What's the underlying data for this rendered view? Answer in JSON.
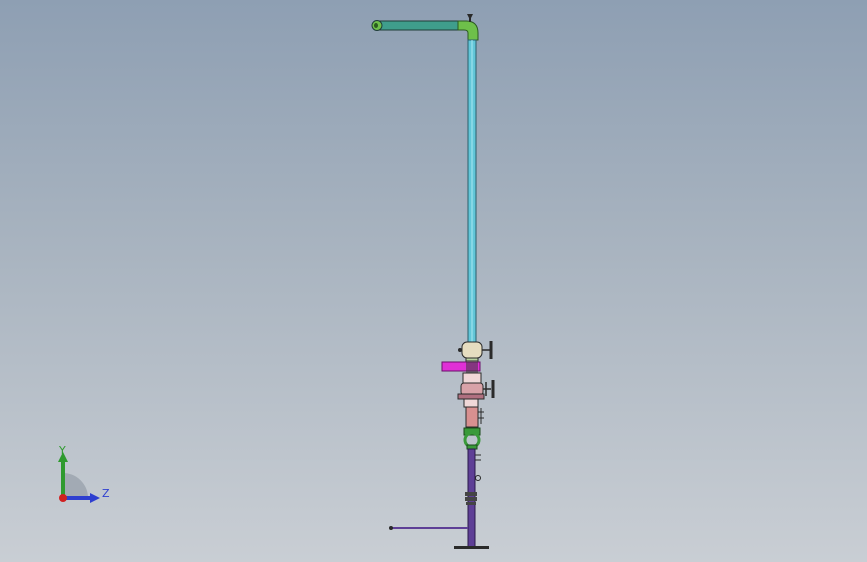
{
  "viewport": {
    "background_top": "#8e9fb3",
    "background_bottom": "#c9ced4"
  },
  "model": {
    "name": "pipe-assembly",
    "colors": {
      "horizontal_pipe": "#3f9e8c",
      "vertical_pipe": "#62c6d8",
      "elbow": "#6ec04a",
      "magenta_part": "#e02fd6",
      "valve_body": "#d8a2a8",
      "lower_pipe": "#5e3f96",
      "fitting_green": "#3a9a3a",
      "dark_outline": "#2a2a2a"
    }
  },
  "triad": {
    "y_label": "Y",
    "z_label": "Z",
    "y_color": "#2f9a2f",
    "z_color": "#2e3fd0",
    "x_color": "#d02020"
  }
}
